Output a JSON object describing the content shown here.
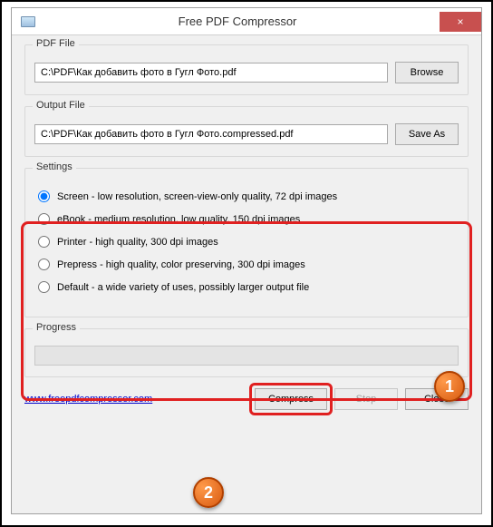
{
  "window": {
    "title": "Free PDF Compressor",
    "close_icon": "×"
  },
  "pdf_file": {
    "group_label": "PDF File",
    "path": "C:\\PDF\\Как добавить фото в Гугл Фото.pdf",
    "browse_label": "Browse"
  },
  "output_file": {
    "group_label": "Output File",
    "path": "C:\\PDF\\Как добавить фото в Гугл Фото.compressed.pdf",
    "saveas_label": "Save As"
  },
  "settings": {
    "group_label": "Settings",
    "options": [
      {
        "label": "Screen - low resolution, screen-view-only quality, 72 dpi images",
        "checked": true
      },
      {
        "label": "eBook - medium resolution, low quality, 150 dpi images",
        "checked": false
      },
      {
        "label": "Printer - high quality, 300 dpi images",
        "checked": false
      },
      {
        "label": "Prepress - high quality, color preserving, 300 dpi images",
        "checked": false
      },
      {
        "label": "Default - a wide variety of uses, possibly larger output file",
        "checked": false
      }
    ]
  },
  "progress": {
    "group_label": "Progress"
  },
  "footer": {
    "link": "www.freepdfcompressor.com",
    "compress_label": "Compress",
    "stop_label": "Stop",
    "close_label": "Close"
  },
  "annotations": {
    "badge1": "1",
    "badge2": "2"
  }
}
